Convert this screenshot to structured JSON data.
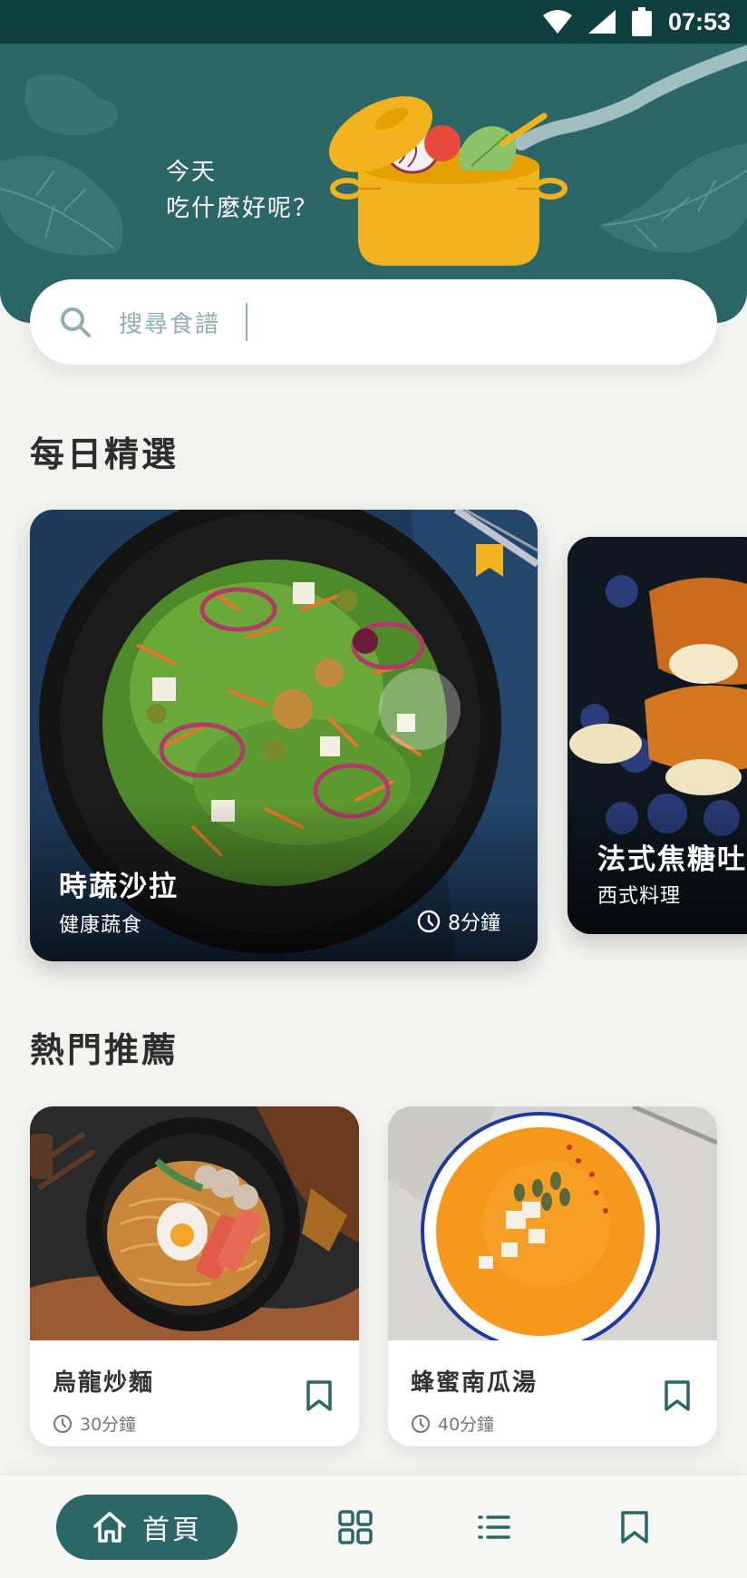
{
  "status_bar": {
    "time": "07:53"
  },
  "header": {
    "greeting_line1": "今天",
    "greeting_line2": "吃什麼好呢？"
  },
  "search": {
    "placeholder": "搜尋食譜"
  },
  "daily": {
    "title": "每日精選",
    "cards": [
      {
        "name": "時蔬沙拉",
        "category": "健康蔬食",
        "time": "8分鐘"
      },
      {
        "name": "法式焦糖吐",
        "category": "西式料理"
      }
    ]
  },
  "hot": {
    "title": "熱門推薦",
    "cards": [
      {
        "name": "烏龍炒麵",
        "time": "30分鐘"
      },
      {
        "name": "蜂蜜南瓜湯",
        "time": "40分鐘"
      }
    ]
  },
  "nav": {
    "home_label": "首頁"
  },
  "colors": {
    "primary": "#2b6767",
    "status_bar": "#103f3f",
    "accent": "#f2b21b",
    "background": "#f3f3f1"
  }
}
